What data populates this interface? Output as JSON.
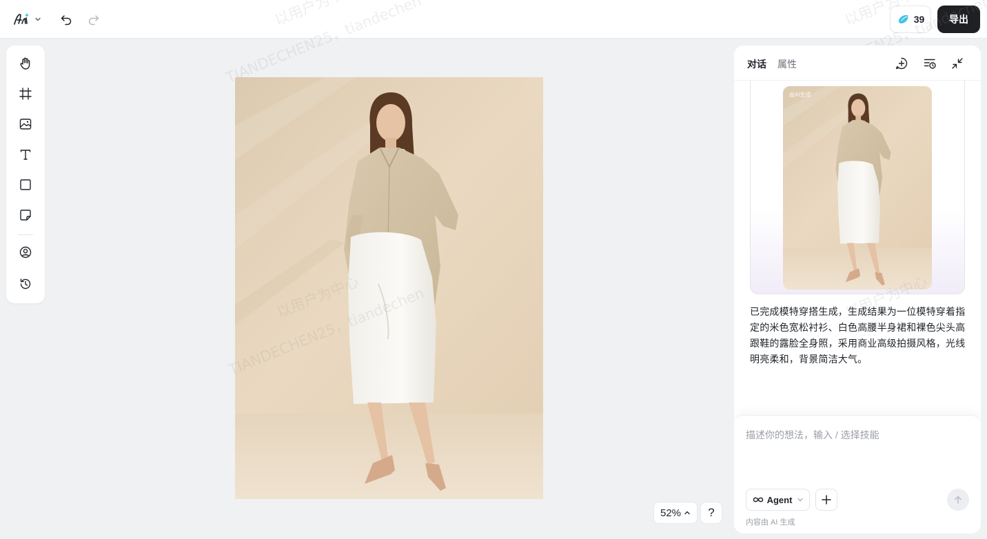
{
  "header": {
    "credits": "39",
    "export_label": "导出"
  },
  "watermark": {
    "line1": "以用户为中心",
    "line2": "TIANDECHEN25，tiandechen"
  },
  "toolbar": {
    "tools": [
      "hand-icon",
      "crop-icon",
      "image-icon",
      "text-icon",
      "rectangle-icon",
      "sticky-note-icon",
      "avatar-icon",
      "history-icon"
    ]
  },
  "canvas": {
    "zoom_label": "52%",
    "help_label": "?"
  },
  "panel": {
    "tabs": [
      {
        "label": "对话",
        "active": true
      },
      {
        "label": "属性",
        "active": false
      }
    ],
    "result_thumb_tag": "由AI生成",
    "result_text": "已完成模特穿搭生成，生成结果为一位模特穿着指定的米色宽松衬衫、白色高腰半身裙和裸色尖头高跟鞋的露脸全身照，采用商业高级拍摄风格，光线明亮柔和，背景简洁大气。",
    "input_placeholder": "描述你的想法，输入 / 选择技能",
    "input_value": "",
    "agent_label": "Agent",
    "ai_note": "内容由 AI 生成"
  },
  "colors": {
    "export_bg": "#1f2023",
    "canvas_bg": "#f0f1f3",
    "photo_wall": "#e8d6bd",
    "credits_icon": "#3fc3e8"
  }
}
